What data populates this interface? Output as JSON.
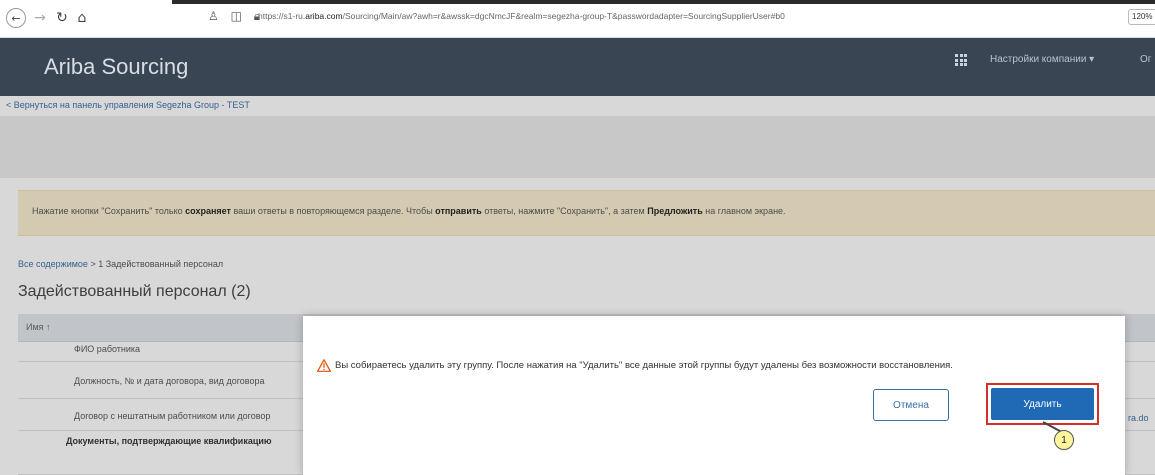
{
  "browser": {
    "url_prefix": "https://s1-ru.",
    "url_domain": "ariba.com",
    "url_rest": "/Sourcing/Main/aw?awh=r&awssk=dgcNmcJF&realm=segezha-group-T&passwordadapter=SourcingSupplierUser#b0",
    "zoom": "120%"
  },
  "header": {
    "title": "Ariba Sourcing",
    "company_settings": "Настройки компании ▾",
    "extra": "Ог"
  },
  "back_link": "< Вернуться на панель управления Segezha Group - TEST",
  "notice": {
    "part1": "Нажатие кнопки \"Сохранить\" только ",
    "bold1": "сохраняет",
    "part2": " ваши ответы в повторяющемся разделе. Чтобы ",
    "bold2": "отправить",
    "part3": " ответы, нажмите \"Сохранить\", а затем ",
    "bold3": "Предложить",
    "part4": " на главном экране."
  },
  "breadcrumb": {
    "link": "Все содержимое",
    "current": " > 1 Задействованный персонал"
  },
  "section_title": "Задействованный персонал (2)",
  "table": {
    "header_name": "Имя ↑",
    "rows": [
      "ФИО работника",
      "Должность, № и дата договора, вид договора",
      "Договор с нештатным работником или договор"
    ],
    "bold_row": "Документы, подтверждающие квалификацию",
    "right_link": "ra.do"
  },
  "dialog": {
    "message": "Вы собираетесь удалить эту группу. После нажатия на \"Удалить\" все данные этой группы будут удалены без возможности восстановления.",
    "cancel_label": "Отмена",
    "delete_label": "Удалить",
    "callout_number": "1"
  },
  "colors": {
    "header_bg": "#3a4553",
    "notice_bg": "#fbeed0",
    "primary_button": "#1f69b5",
    "highlight": "#d32f2f"
  }
}
